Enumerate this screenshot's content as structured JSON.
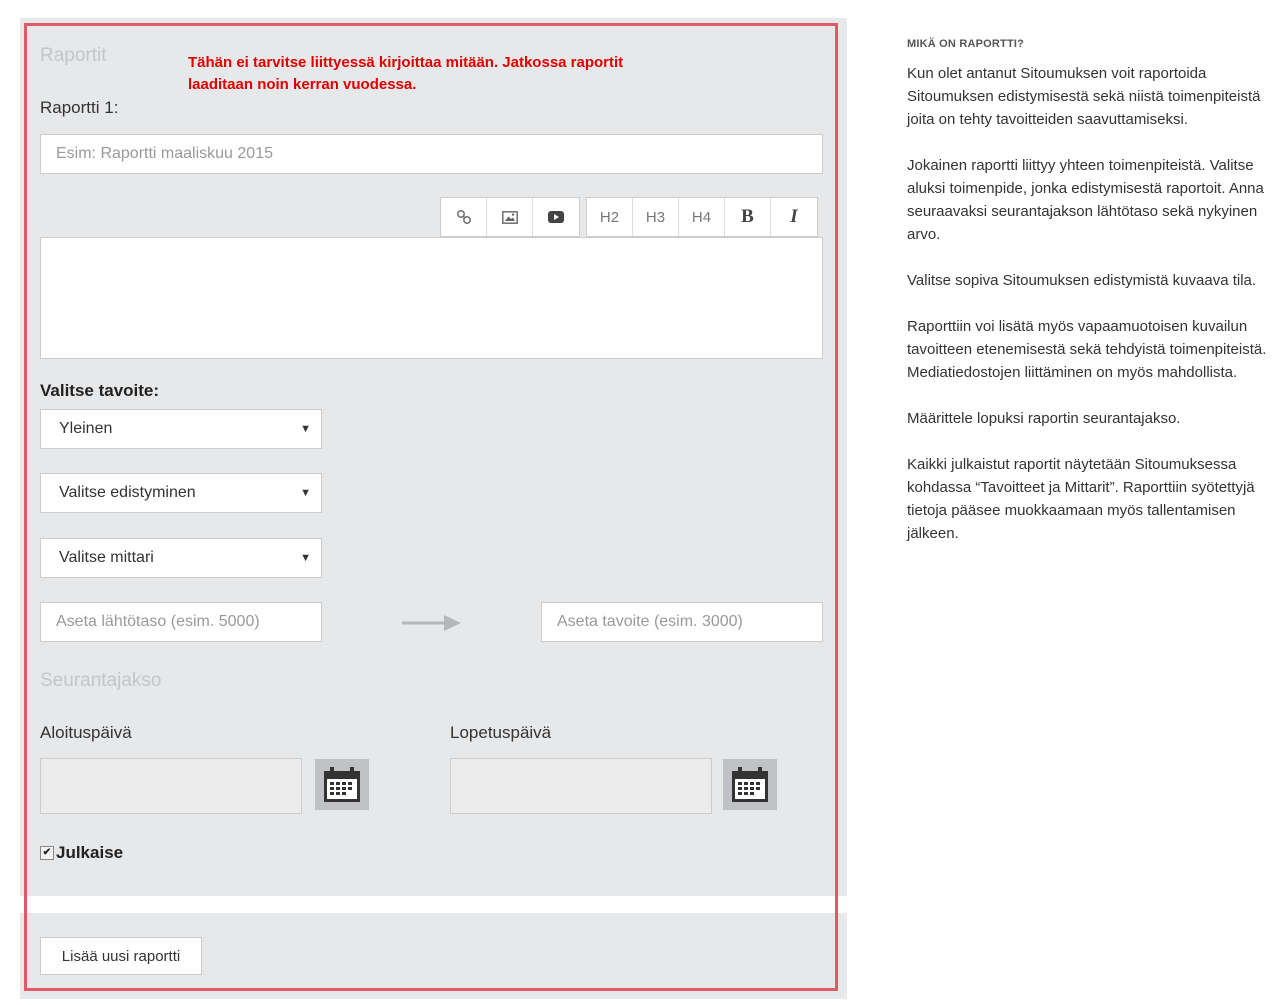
{
  "form": {
    "section_title": "Raportit",
    "note": "Tähän ei tarvitse liittyessä kirjoittaa mitään. Jatkossa raportit laaditaan noin kerran vuodessa.",
    "report_label": "Raportti 1:",
    "title_placeholder": "Esim: Raportti maaliskuu 2015",
    "toolbar": {
      "link_icon": "🔗",
      "image_icon": "image",
      "video_icon": "video",
      "h2": "H2",
      "h3": "H3",
      "h4": "H4",
      "bold": "B",
      "italic": "I"
    },
    "goal_label": "Valitse tavoite:",
    "goal_select": "Yleinen",
    "progress_select": "Valitse edistyminen",
    "metric_select": "Valitse mittari",
    "baseline_placeholder": "Aseta lähtötaso (esim. 5000)",
    "target_placeholder": "Aseta tavoite (esim. 3000)",
    "period_title": "Seurantajakso",
    "start_label": "Aloituspäivä",
    "end_label": "Lopetuspäivä",
    "publish_label": "Julkaise",
    "publish_checked": true,
    "add_button": "Lisää uusi raportti"
  },
  "sidebar": {
    "heading": "MIKÄ ON RAPORTTI?",
    "paragraphs": [
      "Kun olet antanut Sitoumuksen voit raportoida Sitoumuksen edistymisestä sekä niistä toimenpiteistä joita on tehty tavoitteiden saavuttamiseksi.",
      "Jokainen raportti liittyy yhteen toimenpiteistä. Valitse aluksi toimenpide, jonka edistymisestä raportoit. Anna seuraavaksi seurantajakson lähtötaso sekä nykyinen arvo.",
      "Valitse sopiva Sitoumuksen edistymistä kuvaava tila.",
      "Raporttiin voi lisätä myös vapaamuotoisen kuvailun tavoitteen etenemisestä sekä tehdyistä toimenpiteistä. Mediatiedostojen liittäminen on myös mahdollista.",
      "Määrittele lopuksi raportin seurantajakso.",
      "Kaikki julkaistut raportit näytetään Sitoumuksessa kohdassa “Tavoitteet ja Mittarit”. Raporttiin syötettyjä tietoja pääsee muokkaamaan myös tallentamisen jälkeen."
    ]
  },
  "colors": {
    "panel_bg": "#e7e8ea",
    "highlight_outline": "#e05a6a",
    "note_text": "#e00000"
  }
}
